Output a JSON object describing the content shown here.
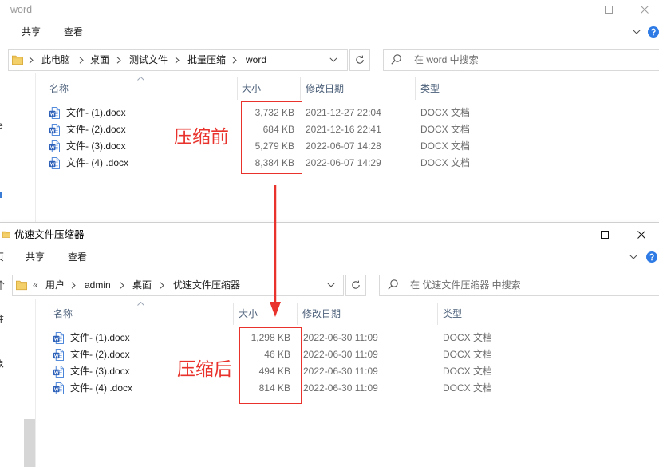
{
  "top_window": {
    "title": "word",
    "ribbon_tabs": [
      "共享",
      "查看"
    ],
    "breadcrumb": [
      "此电脑",
      "桌面",
      "测试文件",
      "批量压缩",
      "word"
    ],
    "search_placeholder": "在 word 中搜索",
    "nav_fragment": "e",
    "columns": {
      "name": "名称",
      "size": "大小",
      "modified": "修改日期",
      "type": "类型"
    },
    "files": [
      {
        "name": "文件- (1).docx",
        "size": "3,732 KB",
        "modified": "2021-12-27 22:04",
        "type": "DOCX 文档"
      },
      {
        "name": "文件- (2).docx",
        "size": "684 KB",
        "modified": "2021-12-16 22:41",
        "type": "DOCX 文档"
      },
      {
        "name": "文件- (3).docx",
        "size": "5,279 KB",
        "modified": "2022-06-07 14:28",
        "type": "DOCX 文档"
      },
      {
        "name": "文件- (4) .docx",
        "size": "8,384 KB",
        "modified": "2022-06-07 14:29",
        "type": "DOCX 文档"
      }
    ]
  },
  "bottom_window": {
    "title": "优速文件压缩器",
    "ribbon_partial_tab": "页",
    "ribbon_tabs": [
      "共享",
      "查看"
    ],
    "breadcrumb_overflow": "«",
    "breadcrumb": [
      "用户",
      "admin",
      "桌面",
      "优速文件压缩器"
    ],
    "search_placeholder": "在 优速文件压缩器 中搜索",
    "nav_fragments": [
      "驻",
      "象"
    ],
    "columns": {
      "name": "名称",
      "size": "大小",
      "modified": "修改日期",
      "type": "类型"
    },
    "files": [
      {
        "name": "文件- (1).docx",
        "size": "1,298 KB",
        "modified": "2022-06-30 11:09",
        "type": "DOCX 文档"
      },
      {
        "name": "文件- (2).docx",
        "size": "46 KB",
        "modified": "2022-06-30 11:09",
        "type": "DOCX 文档"
      },
      {
        "name": "文件- (3).docx",
        "size": "494 KB",
        "modified": "2022-06-30 11:09",
        "type": "DOCX 文档"
      },
      {
        "name": "文件- (4) .docx",
        "size": "814 KB",
        "modified": "2022-06-30 11:09",
        "type": "DOCX 文档"
      }
    ]
  },
  "annotations": {
    "before_label": "压缩前",
    "after_label": "压缩后"
  },
  "colors": {
    "annotation_red": "#e8322b",
    "header_text": "#4c607a",
    "secondary_text": "#6d6d6d",
    "word_icon_blue": "#2b5fb8",
    "folder_yellow": "#f4d06a",
    "help_blue": "#2e7be6"
  },
  "icons": [
    "folder-icon",
    "word-doc-icon",
    "search-icon",
    "refresh-icon",
    "chevron-down-icon",
    "chevron-right-icon",
    "sort-up-icon",
    "help-icon",
    "minimize-icon",
    "maximize-icon",
    "close-icon",
    "up-arrow-icon",
    "down-arrow-annotation"
  ]
}
